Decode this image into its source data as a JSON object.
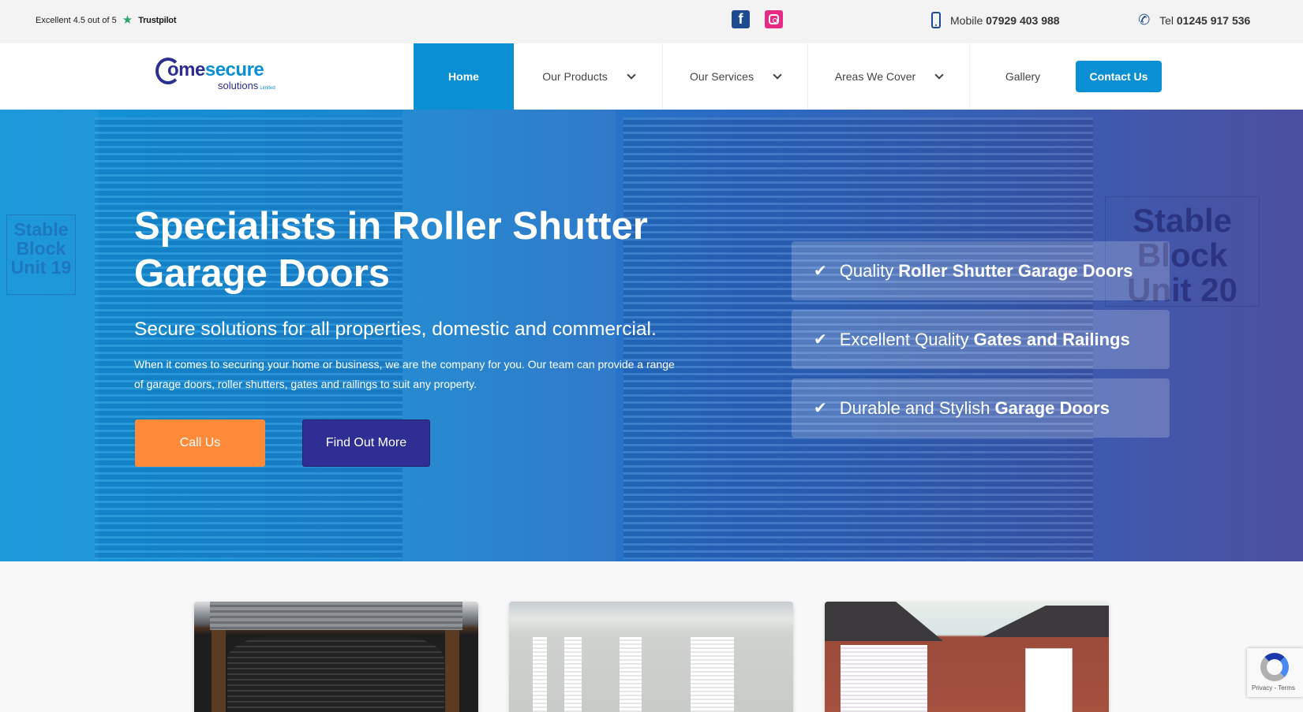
{
  "topbar": {
    "trustpilot": {
      "rating_text": "Excellent 4.5 out of 5",
      "brand": "Trustpilot",
      "star_icon": "star-icon"
    },
    "social": [
      {
        "name": "facebook",
        "icon": "facebook-icon",
        "glyph": "f"
      },
      {
        "name": "instagram",
        "icon": "instagram-icon"
      }
    ],
    "mobile": {
      "label": "Mobile",
      "number": "07929 403 988",
      "icon": "mobile-phone-icon"
    },
    "tel": {
      "label": "Tel",
      "number": "01245 917 536",
      "icon": "phone-icon",
      "glyph": "📞"
    }
  },
  "logo": {
    "part1": "h",
    "part1b": "ome",
    "part2": "secure",
    "sub": "solutions",
    "sub_small": "Limited"
  },
  "nav": {
    "items": [
      {
        "label": "Home",
        "active": true,
        "dropdown": false
      },
      {
        "label": "Our Products",
        "dropdown": true
      },
      {
        "label": "Our Services",
        "dropdown": true
      },
      {
        "label": "Areas We Cover",
        "dropdown": true
      },
      {
        "label": "Gallery",
        "dropdown": false
      }
    ],
    "cta": "Contact Us"
  },
  "hero": {
    "title": "Specialists in Roller Shutter Garage Doors",
    "subtitle": "Secure solutions for all properties, domestic and commercial.",
    "description": "When it comes to securing your home or business, we are the company for you. Our team can provide a range of garage doors, roller shutters, gates and railings to suit any property.",
    "buttons": {
      "call": "Call Us",
      "more": "Find Out More"
    },
    "signs": {
      "left": [
        "Stable",
        "Block",
        "Unit 19"
      ],
      "right": [
        "Stable",
        "Block",
        "Unit 20"
      ]
    },
    "features": [
      {
        "check": "✔",
        "plain": "Quality",
        "bold": "Roller Shutter Garage Doors"
      },
      {
        "check": "✔",
        "plain": "Excellent Quality",
        "bold": "Gates and Railings"
      },
      {
        "check": "✔",
        "plain": "Durable and Stylish",
        "bold": "Garage Doors"
      }
    ]
  },
  "gallery_cards": [
    {
      "subject": "black roller shutter on wooden garden structure"
    },
    {
      "subject": "white roller shutters on commercial units"
    },
    {
      "subject": "white roller garage door on brick bungalow"
    }
  ],
  "recaptcha": {
    "text": "Privacy - Terms"
  },
  "colors": {
    "brand_blue": "#0a8fd5",
    "navy": "#2f2e95",
    "orange": "#ff8a3a",
    "trustpilot_green": "#2aa56b"
  }
}
